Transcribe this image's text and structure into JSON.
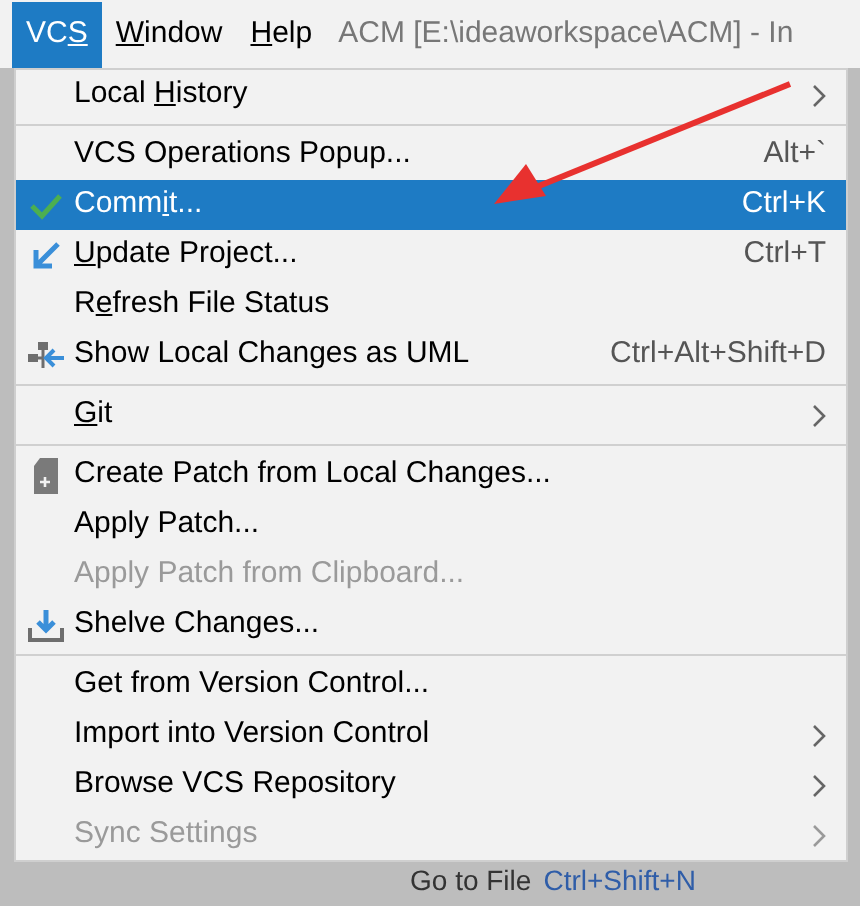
{
  "menubar": [
    {
      "label": {
        "pre": "VC",
        "key": "S"
      },
      "selected": true
    },
    {
      "label": {
        "key": "W",
        "post": "indow"
      },
      "selected": false
    },
    {
      "label": {
        "key": "H",
        "post": "elp"
      },
      "selected": false
    }
  ],
  "window_title": "ACM [E:\\ideaworkspace\\ACM] - In",
  "menu": [
    {
      "kind": "submenu",
      "label": {
        "pre": "Local ",
        "key": "H",
        "post": "istory"
      },
      "selected": false,
      "disabled": false
    },
    {
      "kind": "separator"
    },
    {
      "kind": "plain",
      "label": {
        "pre": "VCS Operations Popup..."
      },
      "shortcut": "Alt+`",
      "selected": false,
      "disabled": false
    },
    {
      "kind": "check",
      "label": {
        "pre": "Comm",
        "key": "i",
        "post": "t..."
      },
      "shortcut": "Ctrl+K",
      "selected": true,
      "disabled": false
    },
    {
      "kind": "update",
      "label": {
        "key": "U",
        "post": "pdate Project..."
      },
      "shortcut": "Ctrl+T",
      "selected": false,
      "disabled": false
    },
    {
      "kind": "plain",
      "label": {
        "pre": "R",
        "key": "e",
        "post": "fresh File Status"
      },
      "selected": false,
      "disabled": false
    },
    {
      "kind": "diagram",
      "label": {
        "pre": "Show Local Changes as UML"
      },
      "shortcut": "Ctrl+Alt+Shift+D",
      "selected": false,
      "disabled": false
    },
    {
      "kind": "separator"
    },
    {
      "kind": "submenu",
      "label": {
        "key": "G",
        "post": "it"
      },
      "selected": false,
      "disabled": false
    },
    {
      "kind": "separator"
    },
    {
      "kind": "patch",
      "label": {
        "pre": "Create Patch from Local Changes..."
      },
      "selected": false,
      "disabled": false
    },
    {
      "kind": "plain",
      "label": {
        "pre": "Apply Patch..."
      },
      "selected": false,
      "disabled": false
    },
    {
      "kind": "plain",
      "label": {
        "pre": "Apply Patch from Clipboard..."
      },
      "selected": false,
      "disabled": true
    },
    {
      "kind": "shelve",
      "label": {
        "pre": "Shelve Changes..."
      },
      "selected": false,
      "disabled": false
    },
    {
      "kind": "separator"
    },
    {
      "kind": "plain",
      "label": {
        "pre": "Get from Version Control..."
      },
      "selected": false,
      "disabled": false
    },
    {
      "kind": "submenu",
      "label": {
        "pre": "Import into Version Control"
      },
      "selected": false,
      "disabled": false
    },
    {
      "kind": "submenu",
      "label": {
        "pre": "Browse VCS Repository"
      },
      "selected": false,
      "disabled": false
    },
    {
      "kind": "submenu",
      "label": {
        "pre": "Sync Settings"
      },
      "selected": false,
      "disabled": true
    }
  ],
  "background_text": {
    "label": "Go to File",
    "shortcut": "Ctrl+Shift+N"
  }
}
